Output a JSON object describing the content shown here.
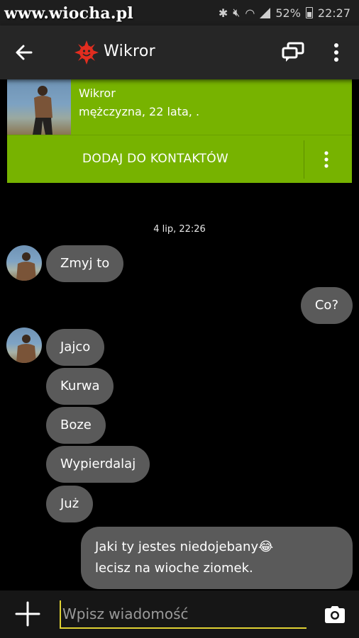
{
  "status_bar": {
    "watermark": "www.wiocha.pl",
    "battery": "52%",
    "time": "22:27"
  },
  "app_bar": {
    "title": "Wikror"
  },
  "profile": {
    "name": "Wikror",
    "info": "mężczyzna, 22 lata, .",
    "add_contact_label": "DODAJ DO KONTAKTÓW"
  },
  "chat": {
    "date_label": "4 lip, 22:26",
    "messages": [
      {
        "side": "in",
        "text": "Zmyj to"
      },
      {
        "side": "out",
        "text": "Co?"
      },
      {
        "side": "in",
        "text": "Jajco"
      },
      {
        "side": "in",
        "text": "Kurwa"
      },
      {
        "side": "in",
        "text": "Boze"
      },
      {
        "side": "in",
        "text": "Wypierdalaj"
      },
      {
        "side": "in",
        "text": "Już"
      },
      {
        "side": "out",
        "line1": "Jaki ty jestes niedojebany",
        "emoji": "😂",
        "line2": "lecisz na wioche ziomek."
      }
    ]
  },
  "input": {
    "placeholder": "Wpisz wiadomość"
  },
  "colors": {
    "accent_green": "#77b300",
    "bubble_gray": "#5a5a5a",
    "input_underline": "#e0d233",
    "logo_red": "#e22d1f"
  },
  "icons": [
    "back-icon",
    "logo-icon",
    "cast-icon",
    "more-icon",
    "plus-icon",
    "camera-icon"
  ]
}
